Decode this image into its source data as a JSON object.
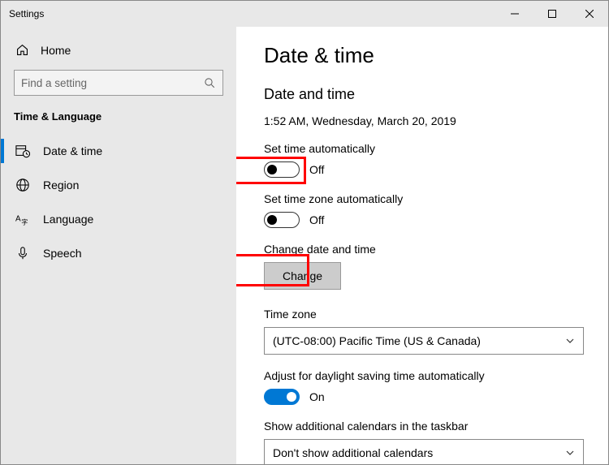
{
  "window": {
    "title": "Settings"
  },
  "sidebar": {
    "home": "Home",
    "search_placeholder": "Find a setting",
    "section": "Time & Language",
    "items": [
      {
        "label": "Date & time"
      },
      {
        "label": "Region"
      },
      {
        "label": "Language"
      },
      {
        "label": "Speech"
      }
    ]
  },
  "page": {
    "title": "Date & time",
    "heading": "Date and time",
    "timestamp": "1:52 AM, Wednesday, March 20, 2019",
    "set_time_auto": {
      "label": "Set time automatically",
      "state": "Off"
    },
    "set_tz_auto": {
      "label": "Set time zone automatically",
      "state": "Off"
    },
    "change_dt": {
      "label": "Change date and time",
      "button": "Change"
    },
    "timezone": {
      "label": "Time zone",
      "value": "(UTC-08:00) Pacific Time (US & Canada)"
    },
    "dst": {
      "label": "Adjust for daylight saving time automatically",
      "state": "On"
    },
    "calendars": {
      "label": "Show additional calendars in the taskbar",
      "value": "Don't show additional calendars"
    }
  },
  "annotations": {
    "highlight_toggle": true,
    "highlight_change_button": true,
    "arrow_from_toggle_to_button": true
  }
}
